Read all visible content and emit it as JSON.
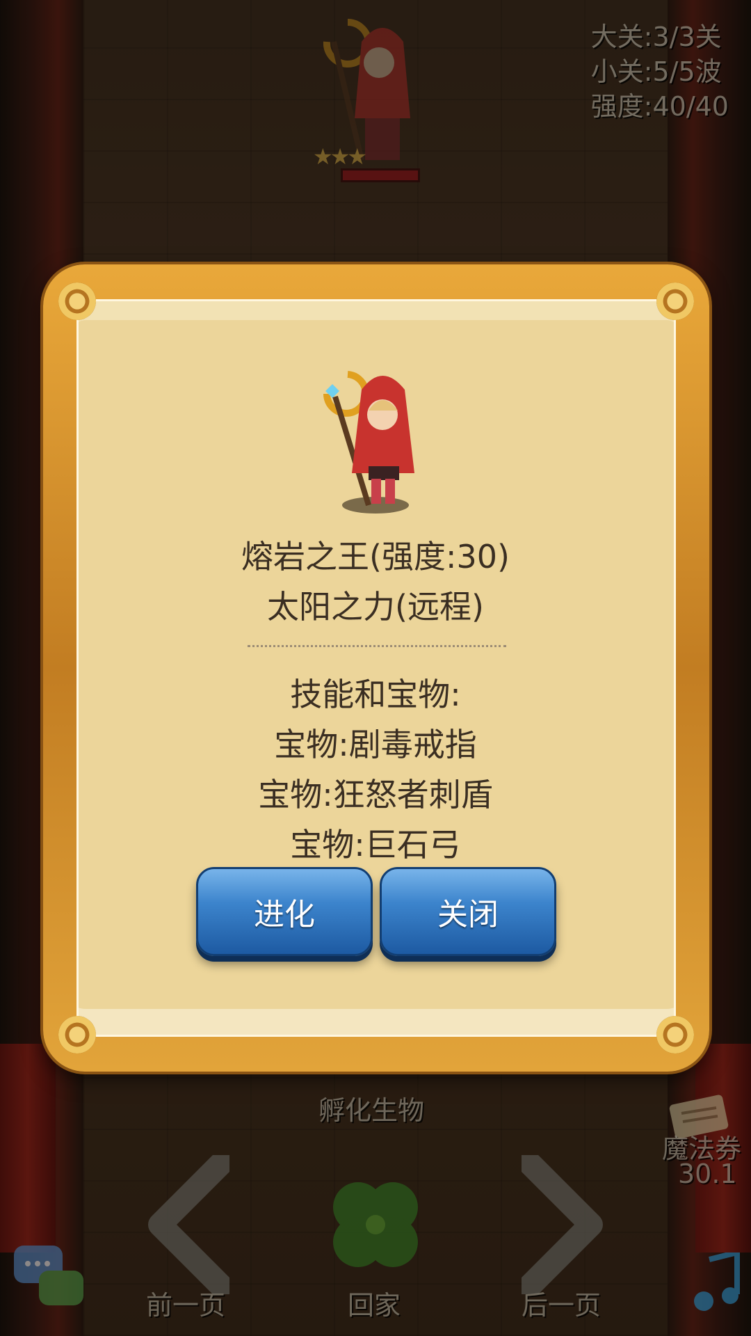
{
  "hud": {
    "stage": "大关:3/3关",
    "wave": "小关:5/5波",
    "strength": "强度:40/40"
  },
  "background": {
    "hatch_label": "孵化生物",
    "magic_ticket_label": "魔法券",
    "magic_ticket_value": "30.1",
    "prev_page_label": "前一页",
    "home_label": "回家",
    "next_page_label": "后一页"
  },
  "dialog": {
    "title": "熔岩之王(强度:30)",
    "subtitle": "太阳之力(远程)",
    "skills_header": "技能和宝物:",
    "items": [
      "宝物:剧毒戒指",
      "宝物:狂怒者刺盾",
      "宝物:巨石弓"
    ],
    "evolve_button": "进化",
    "close_button": "关闭"
  },
  "colors": {
    "panel": "#ecd59a",
    "frame": "#d18f2c",
    "button": "#3c84cc",
    "text": "#3a2e22"
  },
  "icons": [
    "hero-sprite",
    "clover-icon",
    "chat-icon",
    "music-icon",
    "ticket-icon",
    "left-arrow-icon",
    "right-arrow-icon"
  ]
}
